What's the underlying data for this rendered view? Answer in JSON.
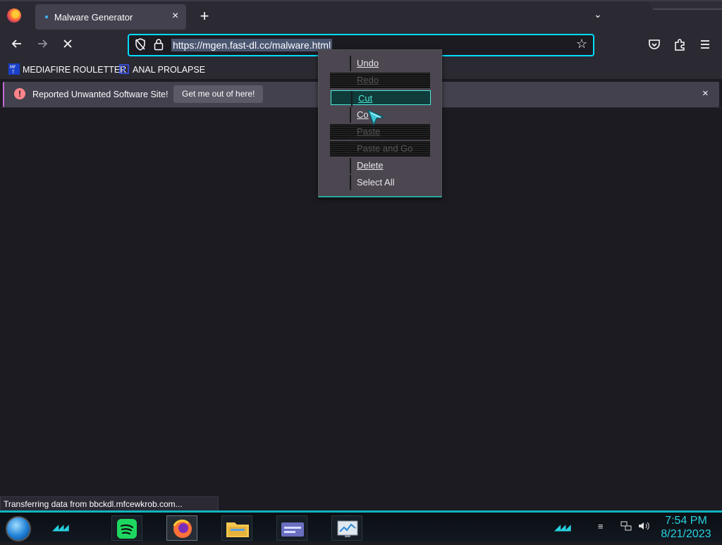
{
  "browser": {
    "tab": {
      "title": "Malware Generator",
      "close": "×"
    },
    "new_tab": "+",
    "tab_list": "⌄",
    "url": "https://mgen.fast-dl.cc/malware.html",
    "bookmarks": [
      {
        "label": "MEDIAFIRE ROULETTER",
        "icon": "mediafire-icon"
      },
      {
        "label": "ANAL PROLAPSE",
        "icon": "bracket-icon"
      }
    ],
    "infobar": {
      "message": "Reported Unwanted Software Site!",
      "button": "Get me out of here!",
      "close": "×"
    },
    "status": "Transferring data from bbckdl.mfcewkrob.com..."
  },
  "context_menu": {
    "items": [
      {
        "label": "Undo",
        "state": "enabled"
      },
      {
        "label": "Redo",
        "state": "disabled"
      },
      {
        "label": "Cut",
        "state": "highlighted"
      },
      {
        "label": "Co",
        "state": "enabled"
      },
      {
        "label": "Paste",
        "state": "disabled"
      },
      {
        "label": "Paste and Go",
        "state": "disabled"
      },
      {
        "label": "Delete",
        "state": "enabled"
      },
      {
        "label": "Select All",
        "state": "enabled"
      }
    ]
  },
  "taskbar": {
    "time": "7:54 PM",
    "date": "8/21/2023",
    "accent": "#27d2e0"
  }
}
